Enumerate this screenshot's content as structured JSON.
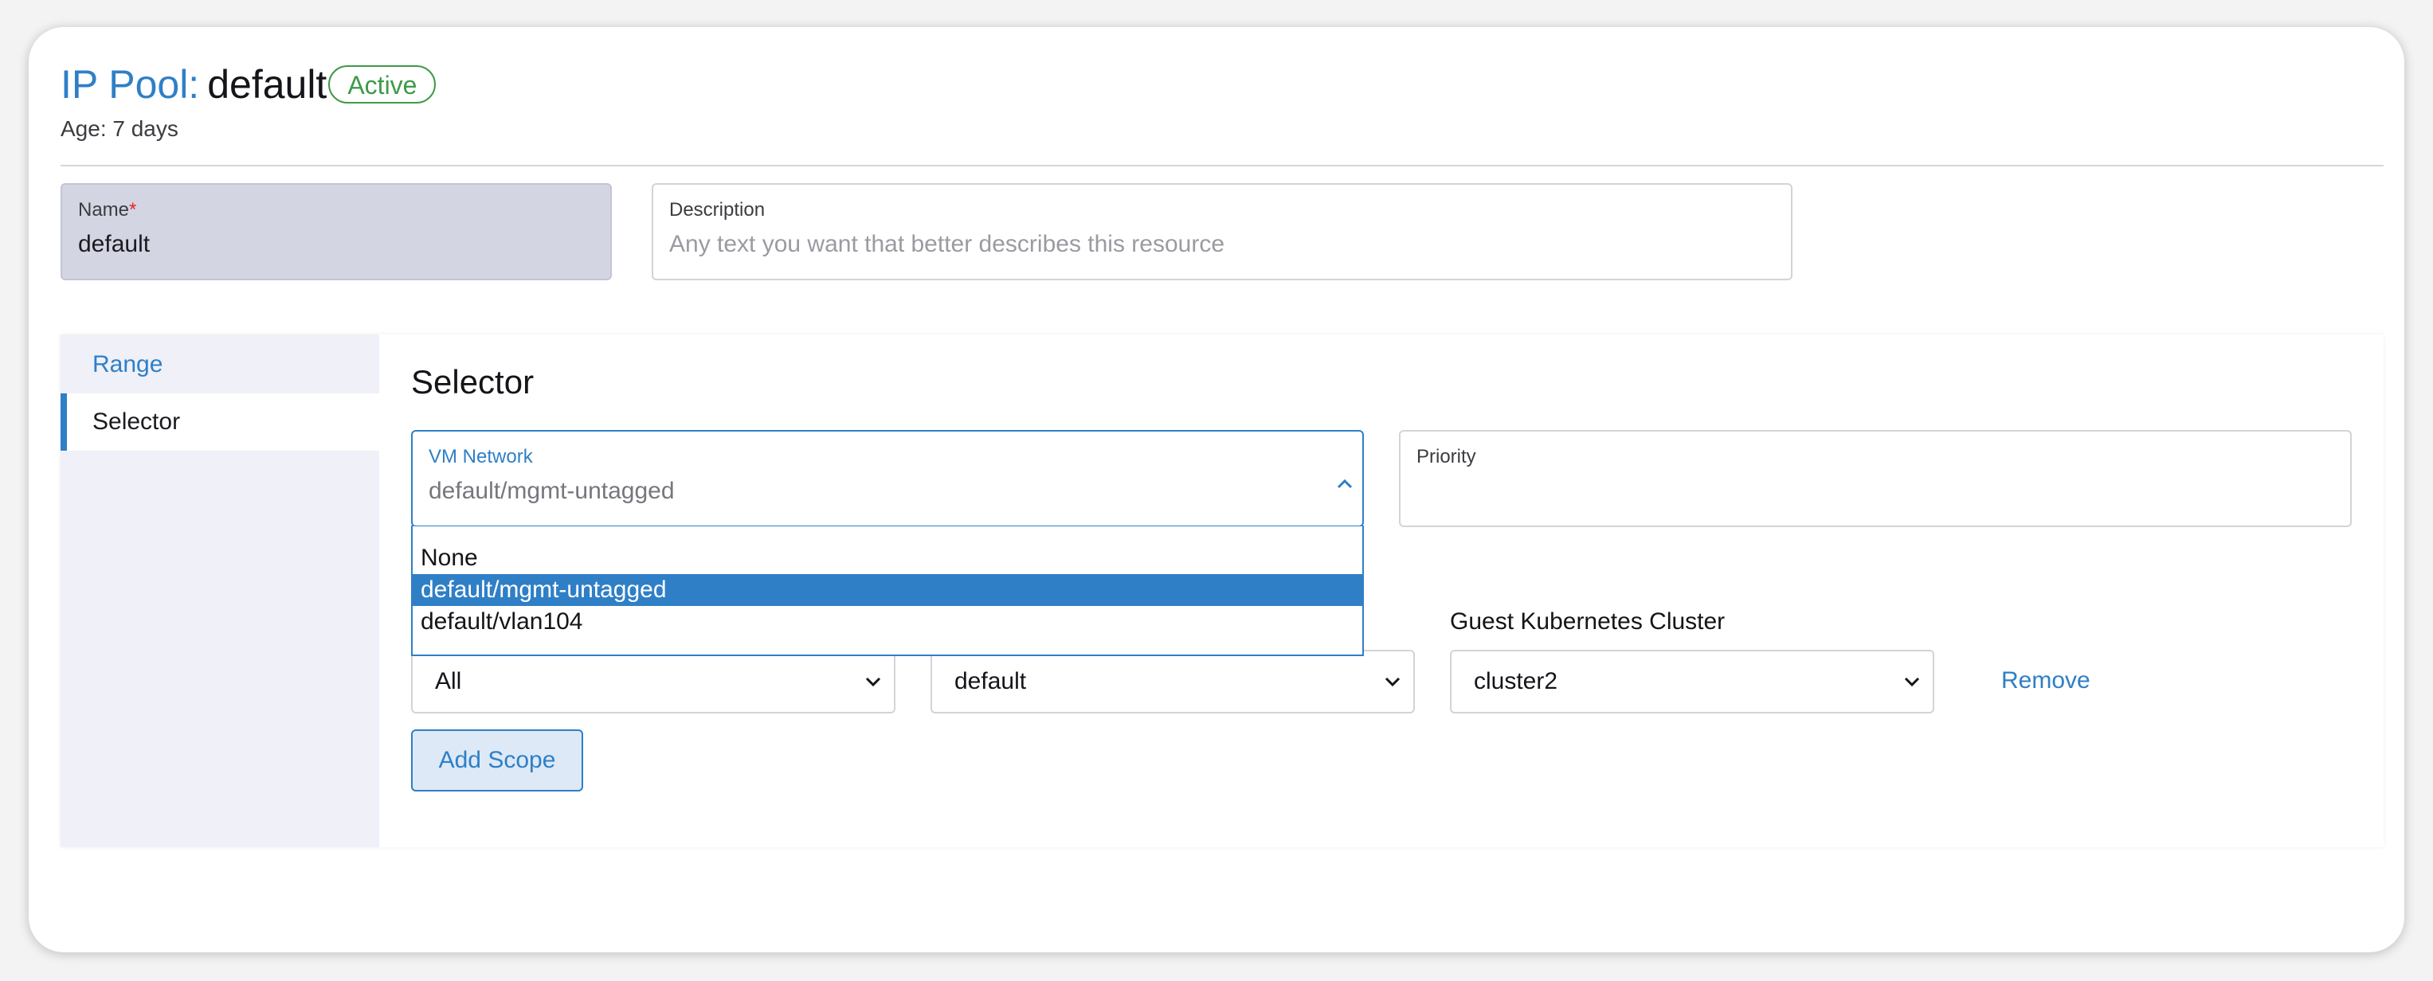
{
  "header": {
    "prefix": "IP Pool:",
    "name": "default",
    "status": "Active",
    "age": "Age: 7 days"
  },
  "name_field": {
    "label": "Name",
    "required_mark": "*",
    "value": "default"
  },
  "description_field": {
    "label": "Description",
    "placeholder": "Any text you want that better describes this resource"
  },
  "tabs": [
    {
      "label": "Range"
    },
    {
      "label": "Selector"
    }
  ],
  "active_tab": "Selector",
  "selector": {
    "title": "Selector",
    "vm_network": {
      "label": "VM Network",
      "value": "default/mgmt-untagged",
      "options": [
        "None",
        "default/mgmt-untagged",
        "default/vlan104"
      ],
      "selected": "default/mgmt-untagged",
      "open": true
    },
    "priority": {
      "label": "Priority",
      "value": ""
    },
    "scope": {
      "cluster_label": "Guest Kubernetes Cluster",
      "namespace_value": "All",
      "network_value": "default",
      "cluster_value": "cluster2",
      "remove_label": "Remove"
    },
    "add_scope_label": "Add Scope"
  },
  "colors": {
    "accent": "#2f7fc6",
    "status_green": "#3e9a48",
    "required_red": "#e02828"
  }
}
